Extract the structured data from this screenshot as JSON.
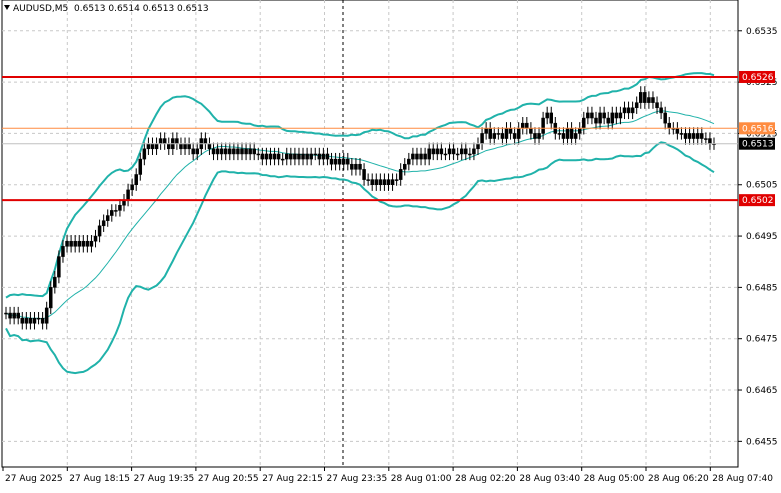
{
  "header": {
    "symbol": "AUDUSD,M5",
    "ohlc": "0.6513 0.6514 0.6513 0.6513"
  },
  "colors": {
    "background": "#ffffff",
    "grid": "#c8c8c8",
    "candle": "#000000",
    "bollinger": "#20b2aa",
    "ma_line": "#20b2aa",
    "level_line": "#e00000",
    "orange_line": "#ff8c40",
    "price_label_bg": "#e00000",
    "current_label_bg": "#000000"
  },
  "chart_data": {
    "type": "candlestick",
    "title": "AUDUSD,M5",
    "ylim": [
      0.645,
      0.6541
    ],
    "y_ticks": [
      "0.6535",
      "0.6525",
      "0.6515",
      "0.6505",
      "0.6495",
      "0.6485",
      "0.6475",
      "0.6465",
      "0.6455"
    ],
    "x_ticks": [
      "27 Aug 2025",
      "27 Aug 18:15",
      "27 Aug 19:35",
      "27 Aug 20:55",
      "27 Aug 22:15",
      "27 Aug 23:35",
      "28 Aug 01:00",
      "28 Aug 02:20",
      "28 Aug 03:40",
      "28 Aug 05:00",
      "28 Aug 06:20",
      "28 Aug 07:40"
    ],
    "horizontal_levels": [
      {
        "price": 0.6526,
        "label": "0.6526",
        "color": "#e00000"
      },
      {
        "price": 0.6502,
        "label": "0.6502",
        "color": "#e00000"
      },
      {
        "price": 0.6516,
        "label": "0.6516",
        "color": "#ff8c40"
      }
    ],
    "current_price": {
      "price": 0.6513,
      "label": "0.6513"
    },
    "close_series": [
      0.648,
      0.6479,
      0.648,
      0.6479,
      0.6478,
      0.6479,
      0.6478,
      0.6479,
      0.6479,
      0.6478,
      0.6481,
      0.6485,
      0.6487,
      0.6491,
      0.6493,
      0.6494,
      0.6493,
      0.6494,
      0.6493,
      0.6494,
      0.6493,
      0.6494,
      0.6495,
      0.6497,
      0.6498,
      0.6499,
      0.65,
      0.65,
      0.6501,
      0.6502,
      0.6504,
      0.6505,
      0.6507,
      0.651,
      0.6512,
      0.6513,
      0.6512,
      0.6513,
      0.6514,
      0.6513,
      0.6512,
      0.6514,
      0.6513,
      0.6512,
      0.6513,
      0.6512,
      0.6511,
      0.6512,
      0.6514,
      0.6513,
      0.6512,
      0.6511,
      0.6512,
      0.6511,
      0.6512,
      0.6511,
      0.6512,
      0.6511,
      0.6512,
      0.6511,
      0.6512,
      0.6511,
      0.6511,
      0.651,
      0.6511,
      0.651,
      0.6511,
      0.651,
      0.651,
      0.6511,
      0.651,
      0.6511,
      0.651,
      0.6511,
      0.651,
      0.6511,
      0.6511,
      0.651,
      0.6511,
      0.651,
      0.6509,
      0.651,
      0.6509,
      0.651,
      0.6509,
      0.6508,
      0.6509,
      0.6508,
      0.6506,
      0.6506,
      0.6505,
      0.6506,
      0.6505,
      0.6506,
      0.6505,
      0.6506,
      0.6506,
      0.6508,
      0.6509,
      0.651,
      0.6511,
      0.651,
      0.6511,
      0.651,
      0.6512,
      0.6511,
      0.6512,
      0.6511,
      0.6511,
      0.6512,
      0.6511,
      0.6511,
      0.6512,
      0.6511,
      0.6511,
      0.6512,
      0.6513,
      0.6515,
      0.6516,
      0.6514,
      0.6515,
      0.6515,
      0.6514,
      0.6516,
      0.6515,
      0.6514,
      0.6516,
      0.6517,
      0.6516,
      0.6515,
      0.6514,
      0.6515,
      0.6518,
      0.6519,
      0.6517,
      0.6515,
      0.6515,
      0.6514,
      0.6516,
      0.6514,
      0.6515,
      0.6516,
      0.6518,
      0.6519,
      0.6518,
      0.6517,
      0.6519,
      0.6518,
      0.6517,
      0.6519,
      0.6518,
      0.6519,
      0.652,
      0.6519,
      0.652,
      0.6521,
      0.6523,
      0.6521,
      0.6522,
      0.6521,
      0.652,
      0.6519,
      0.6517,
      0.6516,
      0.6516,
      0.6515,
      0.6515,
      0.6514,
      0.6515,
      0.6514,
      0.6515,
      0.6514,
      0.6514,
      0.6513,
      0.6513
    ]
  }
}
